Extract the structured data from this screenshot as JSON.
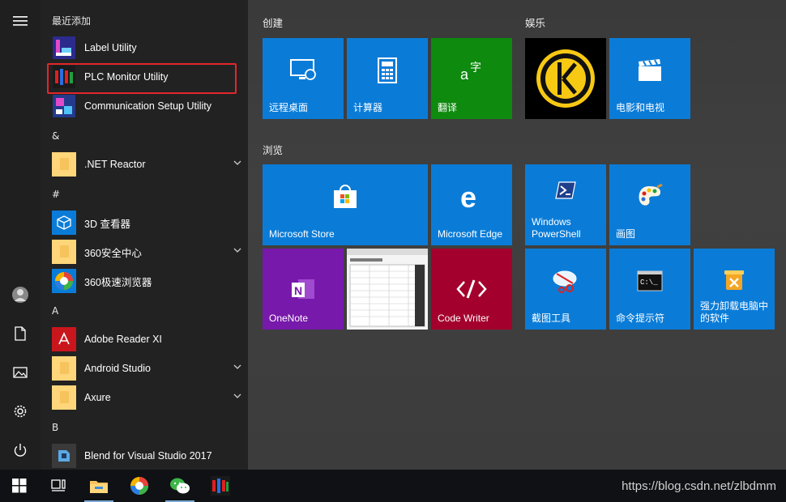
{
  "applist": {
    "sections": [
      {
        "key": "recent",
        "header": "最近添加"
      },
      {
        "key": "amp",
        "header": "&"
      },
      {
        "key": "hash",
        "header": "#"
      },
      {
        "key": "a",
        "header": "A"
      },
      {
        "key": "b",
        "header": "B"
      }
    ],
    "items": [
      {
        "label": "Label Utility",
        "icon": "label-utility-icon"
      },
      {
        "label": "PLC Monitor Utility",
        "icon": "plc-monitor-icon"
      },
      {
        "label": "Communication Setup Utility",
        "icon": "communication-setup-icon"
      },
      {
        "label": ".NET Reactor",
        "icon": "folder-icon"
      },
      {
        "label": "3D 查看器",
        "icon": "3d-viewer-icon"
      },
      {
        "label": "360安全中心",
        "icon": "folder-icon"
      },
      {
        "label": "360极速浏览器",
        "icon": "360-browser-icon"
      },
      {
        "label": "Adobe Reader XI",
        "icon": "adobe-reader-icon"
      },
      {
        "label": "Android Studio",
        "icon": "folder-icon"
      },
      {
        "label": "Axure",
        "icon": "folder-icon"
      },
      {
        "label": "Blend for Visual Studio 2017",
        "icon": "blend-icon"
      }
    ]
  },
  "tiles": {
    "groups": {
      "create": "创建",
      "entertainment": "娱乐",
      "browse": "浏览"
    },
    "items": [
      {
        "label": "远程桌面",
        "icon": "remote-desktop-icon"
      },
      {
        "label": "计算器",
        "icon": "calculator-icon"
      },
      {
        "label": "翻译",
        "icon": "translate-icon"
      },
      {
        "label": "",
        "icon": "keeper-icon"
      },
      {
        "label": "电影和电视",
        "icon": "movies-icon"
      },
      {
        "label": "Microsoft Store",
        "icon": "store-icon"
      },
      {
        "label": "Microsoft Edge",
        "icon": "edge-icon"
      },
      {
        "label": "Windows PowerShell",
        "icon": "powershell-icon"
      },
      {
        "label": "画图",
        "icon": "paint-icon"
      },
      {
        "label": "OneNote",
        "icon": "onenote-icon"
      },
      {
        "label": "",
        "icon": "spreadsheet-thumbnail"
      },
      {
        "label": "Code Writer",
        "icon": "code-writer-icon"
      },
      {
        "label": "截图工具",
        "icon": "snipping-tool-icon"
      },
      {
        "label": "命令提示符",
        "icon": "cmd-icon"
      },
      {
        "label": "强力卸载电脑中的软件",
        "icon": "uninstaller-icon"
      }
    ]
  },
  "watermark": "https://blog.csdn.net/zlbdmm",
  "colors": {
    "tile_blue": "#0a7cd8",
    "tile_green": "#0e8a0e",
    "onenote_purple": "#7719aa",
    "codewriter_red": "#a4002d",
    "highlight_red": "#e3262b"
  }
}
